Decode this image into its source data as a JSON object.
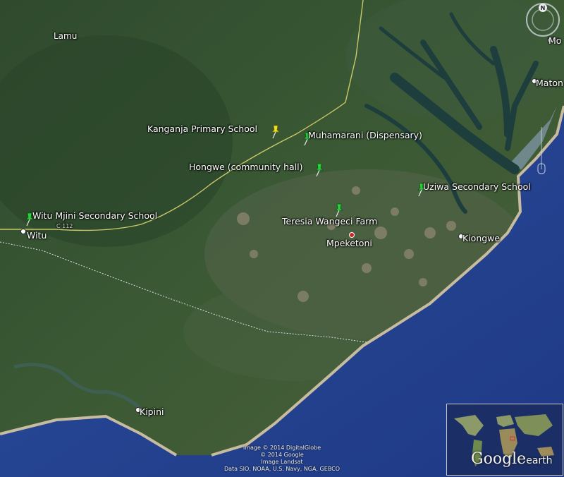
{
  "map": {
    "places": {
      "lamu": "Lamu",
      "witu": "Witu",
      "mpeketoni": "Mpeketoni",
      "kiongwe": "Kiongwe",
      "kipini": "Kipini",
      "mok": "Mo",
      "matondoni": "Maton"
    },
    "road_label": "C 112",
    "placemarks": [
      {
        "name": "Kanganja Primary School",
        "color": "yellow"
      },
      {
        "name": "Muhamarani (Dispensary)",
        "color": "green"
      },
      {
        "name": "Hongwe (community hall)",
        "color": "green"
      },
      {
        "name": "Uziwa Secondary School",
        "color": "green"
      },
      {
        "name": "Witu Mjini Secondary School",
        "color": "green"
      },
      {
        "name": "Teresia Wangeci Farm",
        "color": "green"
      }
    ],
    "pin_colors": {
      "yellow": "#f2e21b",
      "green": "#27d23a"
    },
    "compass_label": "N"
  },
  "credits": {
    "line1": "Image © 2014 DigitalGlobe",
    "line2": "© 2014 Google",
    "line3": "Image Landsat",
    "line4": "Data SIO, NOAA, U.S. Navy, NGA, GEBCO"
  },
  "logo": {
    "main": "Google",
    "sub": "earth"
  }
}
